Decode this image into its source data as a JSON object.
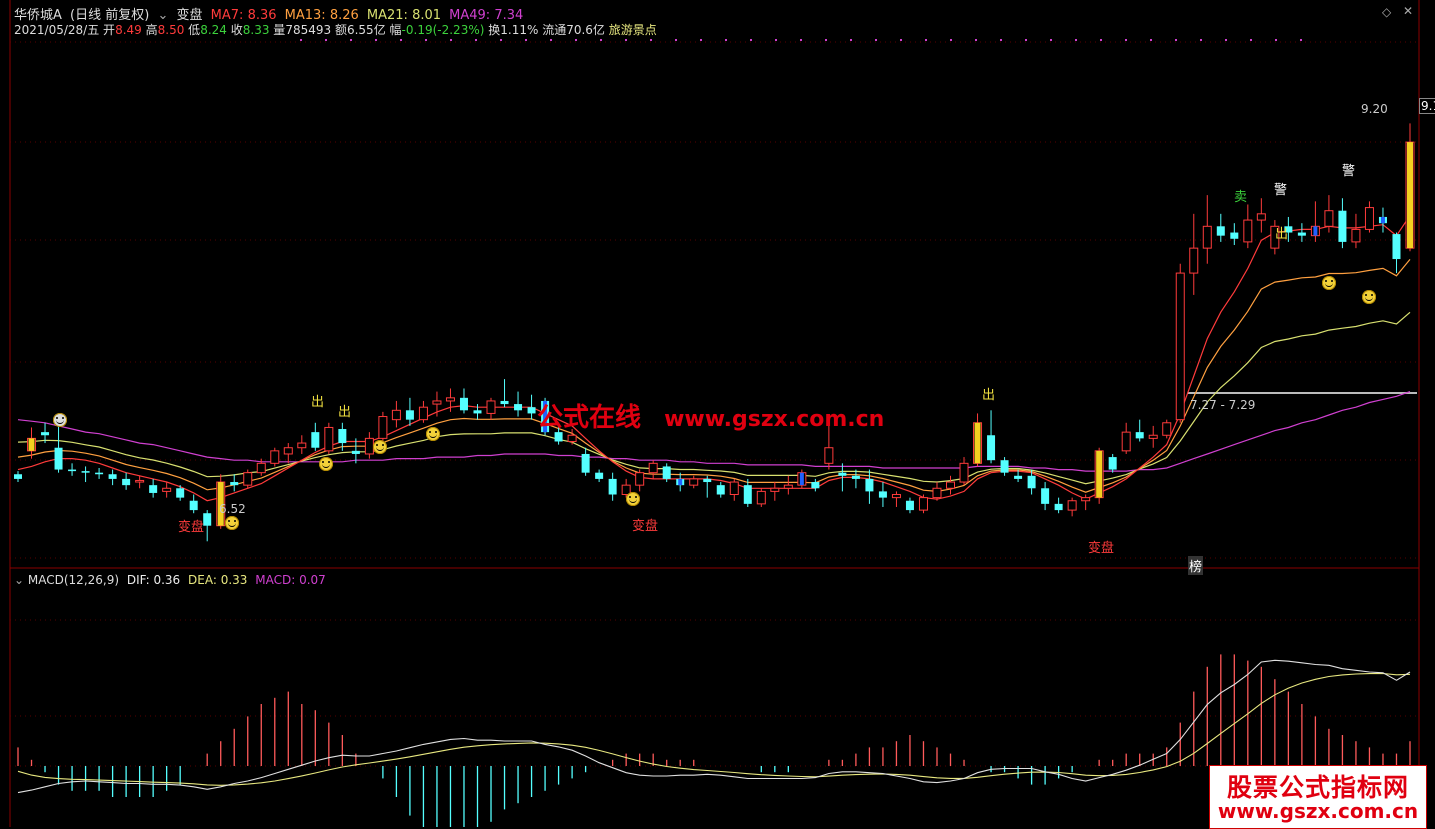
{
  "header": {
    "title": "华侨城A",
    "mode": "(日线 前复权)",
    "indicator": "变盘",
    "ma7": "MA7: 8.36",
    "ma13": "MA13: 8.26",
    "ma21": "MA21: 8.01",
    "ma49": "MA49: 7.34"
  },
  "info": {
    "date": "2021/05/28/五",
    "open_label": "开",
    "open": "8.49",
    "high_label": "高",
    "high": "8.50",
    "low_label": "低",
    "low": "8.24",
    "close_label": "收",
    "close": "8.33",
    "vol_label": "量",
    "vol": "785493",
    "amt_label": "额",
    "amt": "6.55亿",
    "chg_label": "幅",
    "chg": "-0.19(-2.23%)",
    "turn": "换1.11%",
    "float": "流通70.6亿",
    "sector": "旅游景点"
  },
  "price_labels": {
    "high_mark": "9.20",
    "high_mark_cut": "9.1",
    "low_mark": "6.52",
    "range": "7.27 - 7.29"
  },
  "signals": {
    "biapan": "变盘",
    "chu": "出",
    "mai": "卖",
    "jing": "警",
    "bang": "榜"
  },
  "macd": {
    "title": "MACD(12,26,9)",
    "dif": "DIF: 0.36",
    "dea": "DEA: 0.33",
    "macd": "MACD: 0.07"
  },
  "watermark": {
    "text1": "公式在线",
    "url": "www.gszx.com.cn",
    "logo_line1": "股票公式指标网",
    "logo_line2": "www.gszx.com.cn"
  },
  "colors": {
    "up": "#ff3b3b",
    "down": "#54ffff",
    "ma7": "#ff3b3b",
    "ma13": "#ffa040",
    "ma21": "#d8e070",
    "ma49": "#d040d0",
    "dif": "#e0e0e0",
    "dea": "#e8e880"
  },
  "chart_data": {
    "type": "candlestick",
    "candles": [
      [
        6.95,
        6.97,
        6.9,
        6.92
      ],
      [
        7.1,
        7.25,
        7.05,
        7.18
      ],
      [
        7.22,
        7.28,
        7.15,
        7.2
      ],
      [
        7.12,
        7.33,
        6.96,
        6.98
      ],
      [
        6.98,
        7.02,
        6.94,
        6.97
      ],
      [
        6.97,
        7.0,
        6.9,
        6.96
      ],
      [
        6.96,
        6.99,
        6.92,
        6.95
      ],
      [
        6.95,
        6.98,
        6.88,
        6.92
      ],
      [
        6.92,
        6.96,
        6.85,
        6.88
      ],
      [
        6.9,
        6.94,
        6.86,
        6.91
      ],
      [
        6.88,
        6.92,
        6.8,
        6.83
      ],
      [
        6.84,
        6.9,
        6.8,
        6.86
      ],
      [
        6.86,
        6.88,
        6.78,
        6.8
      ],
      [
        6.78,
        6.82,
        6.7,
        6.72
      ],
      [
        6.7,
        6.72,
        6.52,
        6.62
      ],
      [
        6.62,
        6.95,
        6.6,
        6.9
      ],
      [
        6.9,
        6.95,
        6.84,
        6.88
      ],
      [
        6.88,
        6.98,
        6.86,
        6.96
      ],
      [
        6.96,
        7.05,
        6.94,
        7.02
      ],
      [
        7.02,
        7.12,
        7.0,
        7.1
      ],
      [
        7.08,
        7.15,
        7.02,
        7.12
      ],
      [
        7.12,
        7.2,
        7.08,
        7.15
      ],
      [
        7.22,
        7.28,
        7.1,
        7.12
      ],
      [
        7.1,
        7.28,
        7.08,
        7.25
      ],
      [
        7.24,
        7.28,
        7.1,
        7.15
      ],
      [
        7.1,
        7.18,
        7.02,
        7.08
      ],
      [
        7.08,
        7.22,
        7.05,
        7.18
      ],
      [
        7.18,
        7.35,
        7.16,
        7.32
      ],
      [
        7.3,
        7.42,
        7.25,
        7.36
      ],
      [
        7.36,
        7.44,
        7.26,
        7.3
      ],
      [
        7.3,
        7.42,
        7.28,
        7.38
      ],
      [
        7.4,
        7.48,
        7.32,
        7.42
      ],
      [
        7.42,
        7.5,
        7.35,
        7.44
      ],
      [
        7.44,
        7.5,
        7.34,
        7.36
      ],
      [
        7.36,
        7.4,
        7.3,
        7.34
      ],
      [
        7.34,
        7.44,
        7.3,
        7.42
      ],
      [
        7.42,
        7.56,
        7.38,
        7.4
      ],
      [
        7.4,
        7.48,
        7.32,
        7.36
      ],
      [
        7.38,
        7.46,
        7.3,
        7.34
      ],
      [
        7.42,
        7.44,
        7.2,
        7.22
      ],
      [
        7.22,
        7.26,
        7.14,
        7.16
      ],
      [
        7.16,
        7.24,
        7.14,
        7.2
      ],
      [
        7.08,
        7.12,
        6.94,
        6.96
      ],
      [
        6.96,
        6.98,
        6.9,
        6.92
      ],
      [
        6.92,
        6.96,
        6.78,
        6.82
      ],
      [
        6.82,
        6.92,
        6.8,
        6.88
      ],
      [
        6.88,
        6.98,
        6.84,
        6.96
      ],
      [
        6.96,
        7.04,
        6.92,
        7.02
      ],
      [
        7.0,
        7.02,
        6.9,
        6.92
      ],
      [
        6.92,
        6.96,
        6.84,
        6.88
      ],
      [
        6.88,
        6.94,
        6.86,
        6.92
      ],
      [
        6.92,
        6.94,
        6.8,
        6.9
      ],
      [
        6.88,
        6.9,
        6.8,
        6.82
      ],
      [
        6.82,
        6.92,
        6.78,
        6.9
      ],
      [
        6.88,
        6.92,
        6.74,
        6.76
      ],
      [
        6.76,
        6.86,
        6.74,
        6.84
      ],
      [
        6.84,
        6.9,
        6.78,
        6.86
      ],
      [
        6.86,
        6.94,
        6.82,
        6.88
      ],
      [
        6.88,
        6.98,
        6.86,
        6.96
      ],
      [
        6.9,
        6.92,
        6.84,
        6.86
      ],
      [
        7.02,
        7.32,
        6.98,
        7.12
      ],
      [
        6.96,
        7.02,
        6.84,
        6.94
      ],
      [
        6.94,
        6.98,
        6.86,
        6.92
      ],
      [
        6.92,
        6.98,
        6.76,
        6.84
      ],
      [
        6.84,
        6.9,
        6.74,
        6.8
      ],
      [
        6.8,
        6.84,
        6.74,
        6.82
      ],
      [
        6.78,
        6.8,
        6.7,
        6.72
      ],
      [
        6.72,
        6.82,
        6.7,
        6.8
      ],
      [
        6.8,
        6.9,
        6.78,
        6.86
      ],
      [
        6.86,
        6.94,
        6.82,
        6.9
      ],
      [
        6.9,
        7.06,
        6.88,
        7.02
      ],
      [
        7.02,
        7.34,
        7.0,
        7.28
      ],
      [
        7.2,
        7.36,
        7.02,
        7.04
      ],
      [
        7.04,
        7.06,
        6.94,
        6.96
      ],
      [
        6.94,
        6.98,
        6.9,
        6.92
      ],
      [
        6.94,
        6.98,
        6.82,
        6.86
      ],
      [
        6.86,
        6.9,
        6.72,
        6.76
      ],
      [
        6.76,
        6.8,
        6.7,
        6.72
      ],
      [
        6.72,
        6.8,
        6.68,
        6.78
      ],
      [
        6.78,
        6.82,
        6.72,
        6.8
      ],
      [
        6.8,
        7.12,
        6.76,
        7.1
      ],
      [
        7.06,
        7.08,
        6.96,
        6.98
      ],
      [
        7.1,
        7.28,
        7.08,
        7.22
      ],
      [
        7.22,
        7.3,
        7.16,
        7.18
      ],
      [
        7.18,
        7.26,
        7.12,
        7.2
      ],
      [
        7.2,
        7.3,
        7.18,
        7.28
      ],
      [
        7.3,
        8.3,
        7.28,
        8.24
      ],
      [
        8.24,
        8.62,
        8.1,
        8.4
      ],
      [
        8.4,
        8.74,
        8.3,
        8.54
      ],
      [
        8.54,
        8.62,
        8.44,
        8.48
      ],
      [
        8.5,
        8.56,
        8.42,
        8.46
      ],
      [
        8.44,
        8.68,
        8.4,
        8.58
      ],
      [
        8.58,
        8.72,
        8.5,
        8.62
      ],
      [
        8.4,
        8.58,
        8.36,
        8.54
      ],
      [
        8.54,
        8.6,
        8.44,
        8.5
      ],
      [
        8.5,
        8.56,
        8.44,
        8.48
      ],
      [
        8.48,
        8.7,
        8.44,
        8.54
      ],
      [
        8.54,
        8.74,
        8.5,
        8.64
      ],
      [
        8.64,
        8.72,
        8.4,
        8.44
      ],
      [
        8.44,
        8.62,
        8.4,
        8.52
      ],
      [
        8.52,
        8.7,
        8.5,
        8.66
      ],
      [
        8.6,
        8.66,
        8.5,
        8.56
      ],
      [
        8.49,
        8.5,
        8.24,
        8.33
      ],
      [
        8.4,
        9.2,
        8.38,
        9.08
      ]
    ],
    "ma7": [
      6.98,
      7.0,
      7.03,
      7.05,
      7.05,
      7.04,
      7.02,
      6.99,
      6.96,
      6.94,
      6.92,
      6.9,
      6.87,
      6.83,
      6.78,
      6.8,
      6.83,
      6.86,
      6.89,
      6.94,
      6.99,
      7.04,
      7.09,
      7.13,
      7.16,
      7.16,
      7.16,
      7.19,
      7.23,
      7.27,
      7.31,
      7.35,
      7.38,
      7.39,
      7.38,
      7.38,
      7.38,
      7.38,
      7.38,
      7.34,
      7.3,
      7.26,
      7.18,
      7.1,
      7.03,
      6.97,
      6.93,
      6.92,
      6.92,
      6.92,
      6.92,
      6.92,
      6.91,
      6.89,
      6.86,
      6.86,
      6.86,
      6.86,
      6.86,
      6.86,
      6.91,
      6.93,
      6.93,
      6.92,
      6.9,
      6.87,
      6.84,
      6.8,
      6.79,
      6.81,
      6.84,
      6.92,
      6.96,
      6.97,
      6.97,
      6.96,
      6.92,
      6.88,
      6.83,
      6.79,
      6.83,
      6.87,
      6.92,
      6.99,
      7.06,
      7.14,
      7.34,
      7.58,
      7.82,
      7.99,
      8.12,
      8.27,
      8.45,
      8.5,
      8.51,
      8.52,
      8.52,
      8.54,
      8.53,
      8.53,
      8.54,
      8.55,
      8.48,
      8.61
    ],
    "ma49": [
      7.3,
      7.29,
      7.28,
      7.26,
      7.24,
      7.22,
      7.21,
      7.19,
      7.17,
      7.15,
      7.14,
      7.12,
      7.1,
      7.08,
      7.06,
      7.05,
      7.04,
      7.04,
      7.03,
      7.03,
      7.03,
      7.03,
      7.03,
      7.03,
      7.03,
      7.04,
      7.04,
      7.04,
      7.05,
      7.05,
      7.05,
      7.06,
      7.06,
      7.06,
      7.07,
      7.07,
      7.08,
      7.08,
      7.08,
      7.08,
      7.07,
      7.07,
      7.06,
      7.06,
      7.05,
      7.05,
      7.04,
      7.04,
      7.04,
      7.03,
      7.03,
      7.02,
      7.02,
      7.02,
      7.01,
      7.01,
      7.01,
      7.01,
      7.01,
      7.0,
      7.0,
      7.0,
      7.0,
      7.0,
      6.99,
      6.99,
      6.99,
      6.99,
      6.99,
      6.99,
      6.99,
      7.0,
      7.0,
      7.0,
      7.0,
      6.99,
      6.99,
      6.98,
      6.98,
      6.97,
      6.97,
      6.97,
      6.97,
      6.98,
      6.98,
      6.99,
      7.02,
      7.05,
      7.08,
      7.11,
      7.14,
      7.17,
      7.2,
      7.23,
      7.25,
      7.28,
      7.3,
      7.33,
      7.36,
      7.38,
      7.41,
      7.43,
      7.45,
      7.48
    ],
    "macd_bars": [
      0.03,
      0.01,
      -0.01,
      -0.03,
      -0.04,
      -0.04,
      -0.04,
      -0.05,
      -0.05,
      -0.05,
      -0.05,
      -0.04,
      -0.03,
      0.0,
      0.02,
      0.04,
      0.06,
      0.08,
      0.1,
      0.11,
      0.12,
      0.1,
      0.09,
      0.07,
      0.05,
      0.02,
      0.0,
      -0.02,
      -0.05,
      -0.08,
      -0.1,
      -0.12,
      -0.13,
      -0.12,
      -0.1,
      -0.09,
      -0.07,
      -0.06,
      -0.05,
      -0.04,
      -0.03,
      -0.02,
      -0.01,
      0.0,
      0.01,
      0.02,
      0.02,
      0.02,
      0.01,
      0.01,
      0.01,
      0.0,
      0.0,
      0.0,
      0.0,
      -0.01,
      -0.01,
      -0.01,
      0.0,
      0.0,
      0.01,
      0.01,
      0.02,
      0.03,
      0.03,
      0.04,
      0.05,
      0.04,
      0.03,
      0.02,
      0.01,
      0.0,
      -0.01,
      -0.01,
      -0.02,
      -0.03,
      -0.03,
      -0.02,
      -0.01,
      0.0,
      0.01,
      0.01,
      0.02,
      0.02,
      0.02,
      0.03,
      0.07,
      0.12,
      0.16,
      0.18,
      0.18,
      0.17,
      0.16,
      0.14,
      0.12,
      0.1,
      0.08,
      0.06,
      0.05,
      0.04,
      0.03,
      0.02,
      0.02,
      0.04
    ]
  }
}
